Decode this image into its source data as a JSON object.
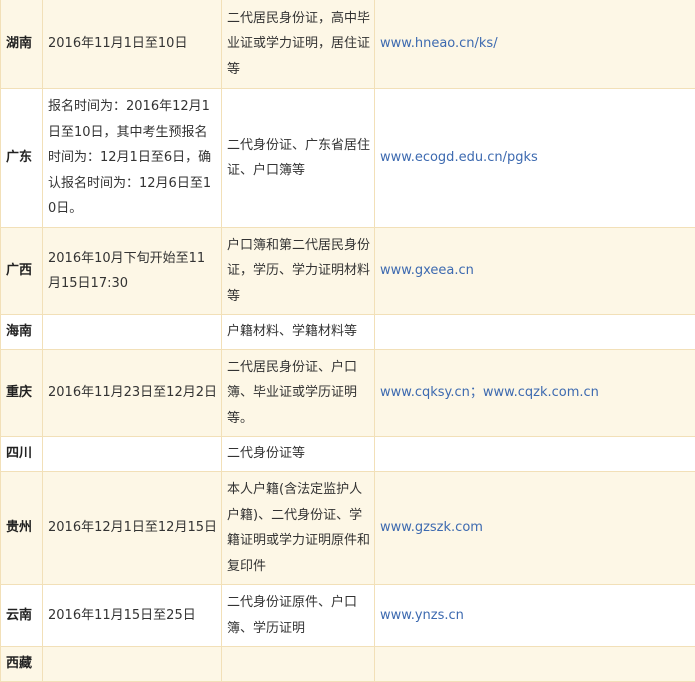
{
  "rows": [
    {
      "province": "湖南",
      "time": "2016年11月1日至10日",
      "documents": "二代居民身份证，高中毕业证或学力证明，居住证等",
      "website": "www.hneao.cn/ks/"
    },
    {
      "province": "广东",
      "time": "报名时间为：2016年12月1日至10日，其中考生预报名时间为：12月1日至6日，确认报名时间为：12月6日至10日。",
      "documents": "二代身份证、广东省居住证、户口簿等",
      "website": "www.ecogd.edu.cn/pgks"
    },
    {
      "province": "广西",
      "time": "2016年10月下旬开始至11月15日17:30",
      "documents": "户口簿和第二代居民身份证，学历、学力证明材料等",
      "website": "www.gxeea.cn"
    },
    {
      "province": "海南",
      "time": "",
      "documents": "户籍材料、学籍材料等",
      "website": ""
    },
    {
      "province": "重庆",
      "time": "2016年11月23日至12月2日",
      "documents": "二代居民身份证、户口簿、毕业证或学历证明等。",
      "website": "www.cqksy.cn；www.cqzk.com.cn"
    },
    {
      "province": "四川",
      "time": "",
      "documents": "二代身份证等",
      "website": ""
    },
    {
      "province": "贵州",
      "time": "2016年12月1日至12月15日",
      "documents": "本人户籍(含法定监护人户籍)、二代身份证、学籍证明或学力证明原件和复印件",
      "website": "www.gzszk.com"
    },
    {
      "province": "云南",
      "time": "2016年11月15日至25日",
      "documents": "二代身份证原件、户口簿、学历证明",
      "website": "www.ynzs.cn"
    },
    {
      "province": "西藏",
      "time": "",
      "documents": "",
      "website": ""
    }
  ]
}
